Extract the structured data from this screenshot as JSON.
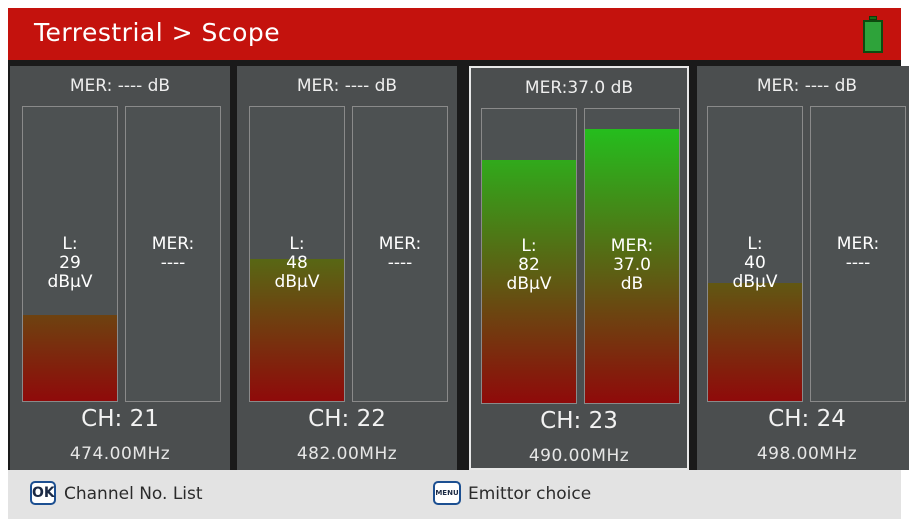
{
  "header": {
    "title": "Terrestrial > Scope",
    "battery_icon": "battery-full-icon"
  },
  "colors": {
    "header_bg": "#c4120d",
    "fill_top": "#1ccc1f",
    "fill_bottom": "#8f0a0a",
    "selected_border": "#e8e8e8"
  },
  "scale": {
    "level_max": 100,
    "mer_max": 40
  },
  "channels": [
    {
      "mer_header": "MER: ---- dB",
      "level_label": "L:\n29\ndBµV",
      "level": 29,
      "mer_label": "MER:\n----",
      "mer": null,
      "ch": "CH: 21",
      "freq": "474.00MHz",
      "selected": false
    },
    {
      "mer_header": "MER: ---- dB",
      "level_label": "L:\n48\ndBµV",
      "level": 48,
      "mer_label": "MER:\n----",
      "mer": null,
      "ch": "CH: 22",
      "freq": "482.00MHz",
      "selected": false
    },
    {
      "mer_header": "MER:37.0 dB",
      "level_label": "L:\n82\ndBµV",
      "level": 82,
      "mer_label": "MER:\n37.0\ndB",
      "mer": 37.0,
      "ch": "CH: 23",
      "freq": "490.00MHz",
      "selected": true
    },
    {
      "mer_header": "MER: ---- dB",
      "level_label": "L:\n40\ndBµV",
      "level": 40,
      "mer_label": "MER:\n----",
      "mer": null,
      "ch": "CH: 24",
      "freq": "498.00MHz",
      "selected": false
    }
  ],
  "footer": {
    "ok_key": "OK",
    "ok_label": "Channel No. List",
    "menu_key": "MENU",
    "menu_label": "Emittor choice"
  }
}
